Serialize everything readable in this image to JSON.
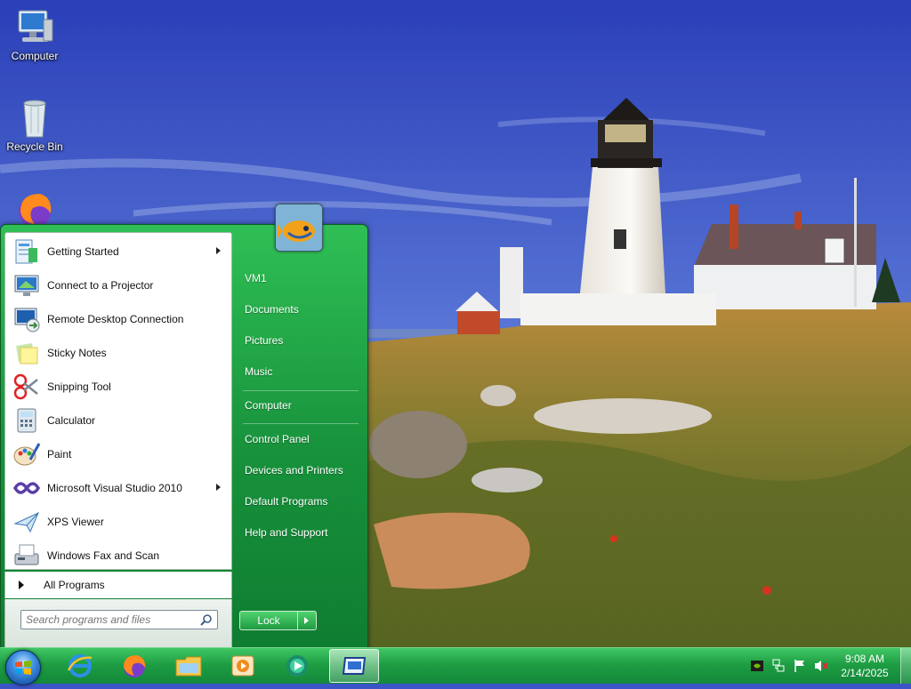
{
  "desktop": {
    "icons": [
      {
        "label": "Computer",
        "icon": "computer-icon"
      },
      {
        "label": "Recycle Bin",
        "icon": "recycle-bin-icon"
      },
      {
        "label": "",
        "icon": "firefox-icon"
      }
    ]
  },
  "start_menu": {
    "programs": [
      {
        "label": "Getting Started",
        "icon": "getting-started-icon",
        "has_submenu": true
      },
      {
        "label": "Connect to a Projector",
        "icon": "projector-icon",
        "has_submenu": false
      },
      {
        "label": "Remote Desktop Connection",
        "icon": "remote-desktop-icon",
        "has_submenu": false
      },
      {
        "label": "Sticky Notes",
        "icon": "sticky-notes-icon",
        "has_submenu": false
      },
      {
        "label": "Snipping Tool",
        "icon": "snipping-tool-icon",
        "has_submenu": false
      },
      {
        "label": "Calculator",
        "icon": "calculator-icon",
        "has_submenu": false
      },
      {
        "label": "Paint",
        "icon": "paint-icon",
        "has_submenu": false
      },
      {
        "label": "Microsoft Visual Studio 2010",
        "icon": "visual-studio-icon",
        "has_submenu": true
      },
      {
        "label": "XPS Viewer",
        "icon": "xps-viewer-icon",
        "has_submenu": false
      },
      {
        "label": "Windows Fax and Scan",
        "icon": "fax-scan-icon",
        "has_submenu": false
      }
    ],
    "all_programs": "All Programs",
    "search": {
      "placeholder": "Search programs and files"
    },
    "right_items": [
      "VM1",
      "Documents",
      "Pictures",
      "Music",
      "Computer",
      "Control Panel",
      "Devices and Printers",
      "Default Programs",
      "Help and Support"
    ],
    "lock_label": "Lock"
  },
  "taskbar": {
    "pinned": [
      {
        "icon": "internet-explorer-icon"
      },
      {
        "icon": "firefox-icon"
      },
      {
        "icon": "file-explorer-icon"
      },
      {
        "icon": "media-player-icon"
      },
      {
        "icon": "media-center-icon"
      },
      {
        "icon": "remote-window-icon",
        "active": true
      }
    ],
    "tray": [
      "nvidia-icon",
      "network-icon",
      "action-center-flag-icon",
      "volume-muted-icon"
    ],
    "time": "9:08 AM",
    "date": "2/14/2025"
  },
  "colors": {
    "start_menu_green": "#17913b",
    "taskbar_green": "#1e9e43",
    "sky": "#3b55c8"
  }
}
